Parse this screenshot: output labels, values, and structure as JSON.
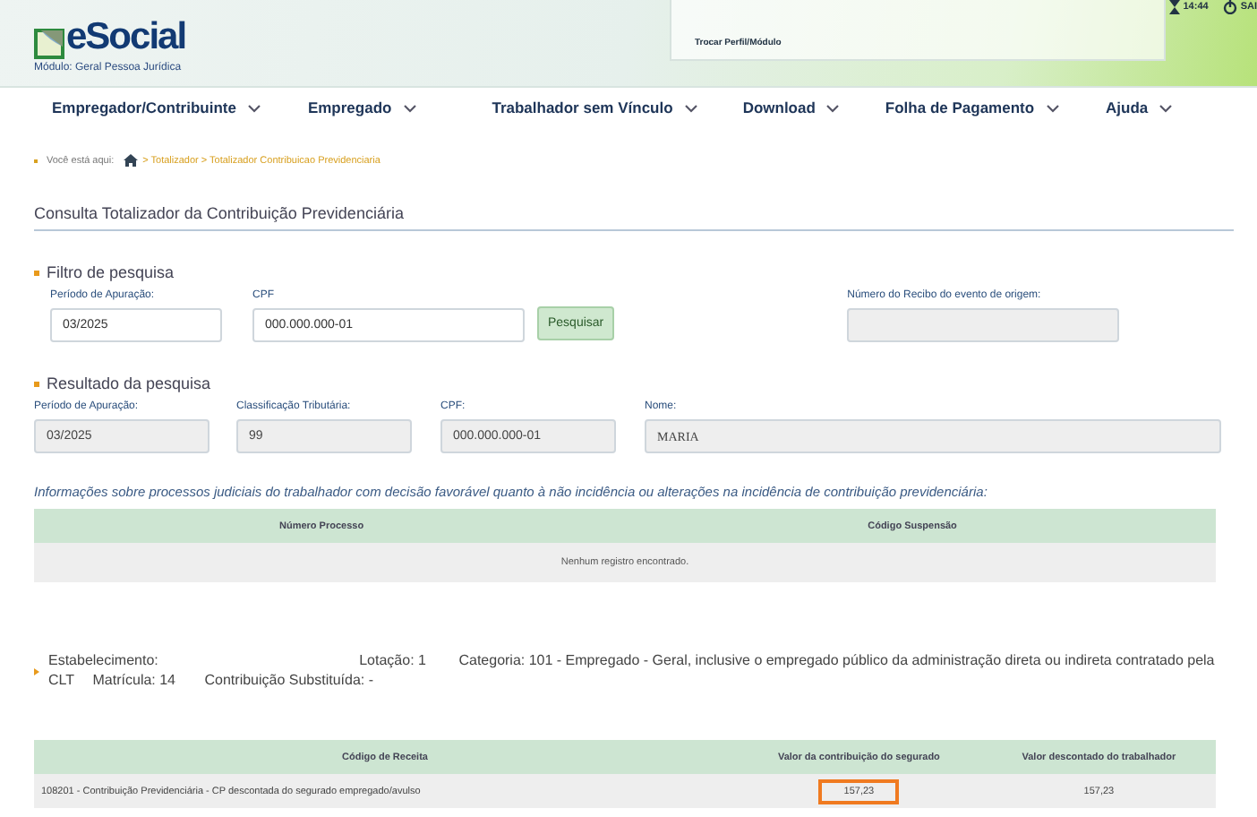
{
  "header": {
    "logo": "eSocial",
    "module": "Módulo: Geral Pessoa Jurídica",
    "profile_link": "Trocar Perfil/Módulo",
    "time": "14:44",
    "logout": "SAI"
  },
  "nav": [
    "Empregador/Contribuinte",
    "Empregado",
    "Trabalhador sem Vínculo",
    "Download",
    "Folha de Pagamento",
    "Ajuda"
  ],
  "breadcrumb": {
    "label": "Você está aqui:",
    "path": "> Totalizador > Totalizador Contribuicao Previdenciaria"
  },
  "page_title": "Consulta Totalizador da Contribuição Previdenciária",
  "filter": {
    "title": "Filtro de pesquisa",
    "fields": [
      {
        "label": "Período de Apuração:",
        "value": "03/2025"
      },
      {
        "label": "CPF",
        "value": "000.000.000-01"
      }
    ],
    "button": "Pesquisar",
    "receipt": {
      "label": "Número do Recibo do evento de origem:",
      "disabled": true
    }
  },
  "result": {
    "title": "Resultado da pesquisa",
    "fields": [
      {
        "label": "Período de Apuração:",
        "value": "03/2025"
      },
      {
        "label": "Classificação Tributária:",
        "value": "99"
      },
      {
        "label": "CPF:",
        "value": "000.000.000-01"
      },
      {
        "label": "Nome:",
        "value": "MARIA"
      }
    ]
  },
  "judicial": {
    "title": "Informações sobre processos judiciais do trabalhador com decisão favorável quanto à não incidência ou alterações na incidência de contribuição previdenciária:",
    "columns": [
      "Número Processo",
      "Código Suspensão"
    ],
    "empty": "Nenhum registro encontrado."
  },
  "establishment": {
    "items": [
      "Estabelecimento:",
      "Lotação: 1",
      "Categoria: 101 - Empregado - Geral, inclusive o empregado público da administração direta ou indireta contratado pela CLT",
      "Matrícula: 14",
      "Contribuição Substituída: -"
    ]
  },
  "revenue": {
    "columns": [
      "Código de Receita",
      "Valor da contribuição do segurado",
      "Valor descontado do trabalhador"
    ],
    "rows": [
      {
        "cells": [
          {
            "text": "108201 - Contribuição Previdenciária - CP descontada do segurado empregado/avulso",
            "highlighted": false
          },
          {
            "text": "157,23",
            "highlighted": true
          },
          {
            "text": "157,23",
            "highlighted": false
          }
        ]
      }
    ]
  }
}
